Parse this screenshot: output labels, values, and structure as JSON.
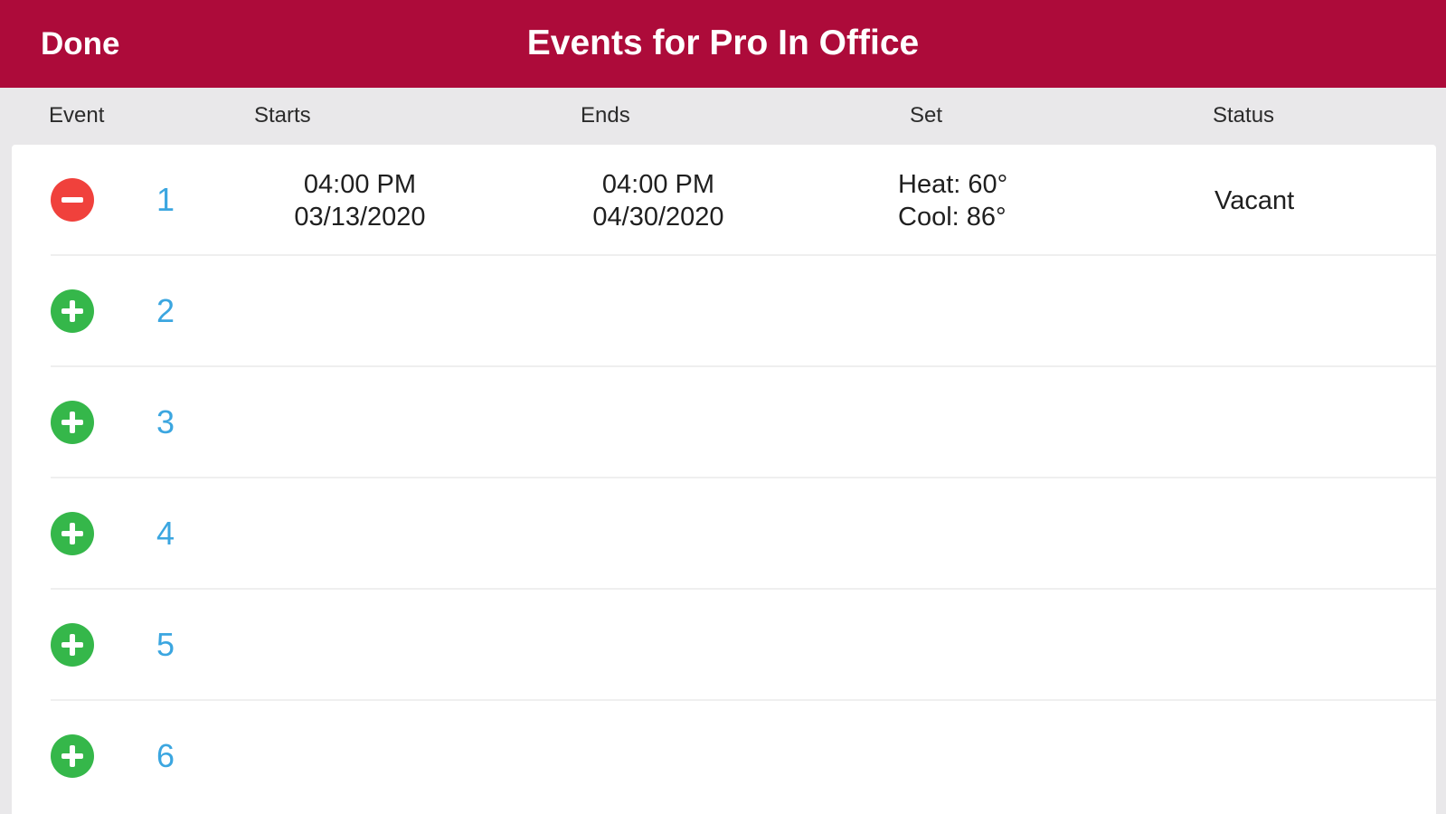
{
  "navbar": {
    "done_label": "Done",
    "title": "Events for Pro In Office",
    "background": "#ad0b3a"
  },
  "table": {
    "columns": [
      "Event",
      "Starts",
      "Ends",
      "Set",
      "Status"
    ],
    "rows": [
      {
        "action": "remove",
        "action_icon": "minus-circle-icon",
        "number": "1",
        "start_time": "04:00 PM",
        "start_date": "03/13/2020",
        "end_time": "04:00 PM",
        "end_date": "04/30/2020",
        "heat": "Heat: 60°",
        "cool": "Cool: 86°",
        "status": "Vacant"
      },
      {
        "action": "add",
        "action_icon": "plus-circle-icon",
        "number": "2"
      },
      {
        "action": "add",
        "action_icon": "plus-circle-icon",
        "number": "3"
      },
      {
        "action": "add",
        "action_icon": "plus-circle-icon",
        "number": "4"
      },
      {
        "action": "add",
        "action_icon": "plus-circle-icon",
        "number": "5"
      },
      {
        "action": "add",
        "action_icon": "plus-circle-icon",
        "number": "6"
      }
    ]
  },
  "colors": {
    "remove": "#f0413c",
    "add": "#35b74a",
    "event_number": "#3ba6e0",
    "header_background": "#e9e8ea"
  }
}
